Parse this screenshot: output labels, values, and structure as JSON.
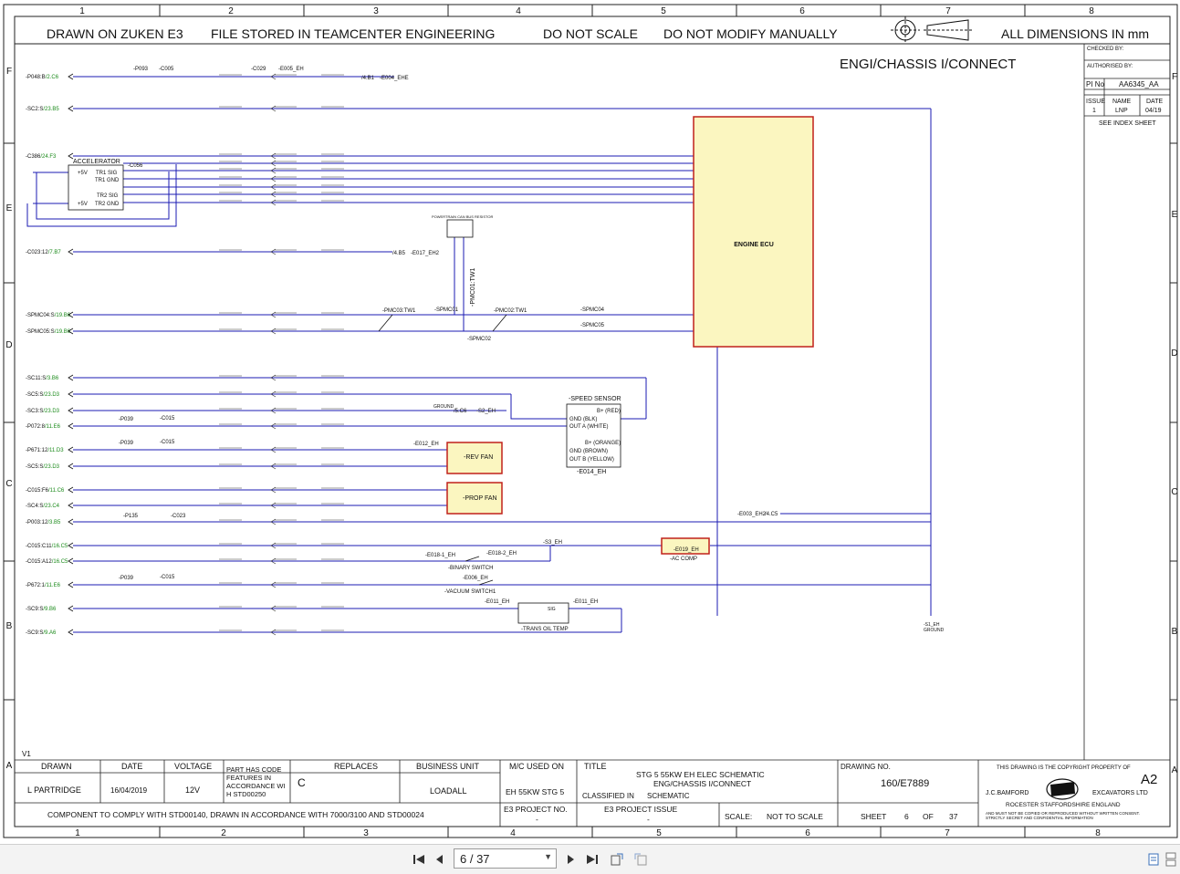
{
  "header": {
    "notes": [
      "DRAWN ON ZUKEN E3",
      "FILE STORED IN TEAMCENTER ENGINEERING",
      "DO NOT SCALE",
      "DO NOT MODIFY MANUALLY"
    ],
    "dimensions": "ALL DIMENSIONS IN mm",
    "sheet_title": "ENGI/CHASSIS I/CONNECT"
  },
  "grid": {
    "columns": [
      "1",
      "2",
      "3",
      "4",
      "5",
      "6",
      "7",
      "8"
    ],
    "rows": [
      "F",
      "E",
      "D",
      "C",
      "B",
      "A"
    ]
  },
  "approval": {
    "checked_by": "CHECKED BY:",
    "authorised_by": "AUTHORISED BY:",
    "pi_label": "PI No",
    "pi_value": "AA6345_AA",
    "issue_label": "ISSUE",
    "name_label": "NAME",
    "date_label": "DATE",
    "issue": "1",
    "name": "LNP",
    "date": "04/19",
    "index_note": "SEE INDEX SHEET"
  },
  "schematic": {
    "left_refs": [
      {
        "ref": "-P048:B",
        "dest": "/2.C6"
      },
      {
        "ref": "-SC2:S",
        "dest": "/23.B5"
      },
      {
        "ref": "-C386",
        "dest": "/24.F3"
      },
      {
        "ref": "-C023:12",
        "dest": "/7.B7"
      },
      {
        "ref": "-SPMC04:S",
        "dest": "/19.B6"
      },
      {
        "ref": "-SPMC05:S",
        "dest": "/19.B6"
      },
      {
        "ref": "-SC11:S",
        "dest": "/3.B6"
      },
      {
        "ref": "-SC5:S",
        "dest": "/23.D3"
      },
      {
        "ref": "-SC3:S",
        "dest": "/23.D3"
      },
      {
        "ref": "-P072:8",
        "dest": "/11.E6"
      },
      {
        "ref": "-P671:12",
        "dest": "/11.D3"
      },
      {
        "ref": "-SC5:S",
        "dest": "/23.D3"
      },
      {
        "ref": "-C015:F6",
        "dest": "/11.C6"
      },
      {
        "ref": "-SC4:S",
        "dest": "/23.C4"
      },
      {
        "ref": "-P003:12",
        "dest": "/3.B5"
      },
      {
        "ref": "-C015:C11",
        "dest": "/16.C5"
      },
      {
        "ref": "-C015:A12",
        "dest": "/16.C5"
      },
      {
        "ref": "-P672:1",
        "dest": "/11.E6"
      },
      {
        "ref": "-SC9:S",
        "dest": "/9.B6"
      },
      {
        "ref": "-SC9:S",
        "dest": "/9.A6"
      }
    ],
    "accelerator": {
      "title": "ACCELERATOR",
      "conn": "-C056",
      "pins": [
        "+5V",
        "TR1 SIG",
        "TR1 GND",
        "TR2 SIG",
        "TR2 GND",
        "+5V"
      ]
    },
    "ecu": {
      "label": "ENGINE ECU"
    },
    "can_resistor": "POWERTRAIN CAN BUS RESISTOR",
    "speed_sensor": {
      "title": "-SPEED SENSOR",
      "ref": "-E014_EH",
      "pins": [
        "B+ (RED)",
        "GND (BLK)",
        "OUT A (WHITE)",
        "B+ (ORANGE)",
        "GND (BROWN)",
        "OUT B (YELLOW)"
      ]
    },
    "rev_fan": "-REV FAN",
    "prop_fan": "-PROP FAN",
    "ac_comp": {
      "label": "-AC COMP",
      "ref": "-E019_EH"
    },
    "binary_switch": "-BINARY SWITCH",
    "vacuum_switch": "-VACUUM SWITCH1",
    "trans_oil_temp": "-TRANS OIL TEMP",
    "ground": {
      "ref": "-S1_EH",
      "label": "GROUND"
    },
    "labels": {
      "p093": "-P093",
      "c005": "-C005",
      "c029": "-C029",
      "e005": "-E005_EH",
      "e004": "-E004_EHE",
      "e004_dest": "/4.B1",
      "e017": "-E017_EH2",
      "e017_dest": "/4.B5",
      "pmc03": "-PMC03:TW1",
      "pmc02": "-PMC02:TW1",
      "pmc01": "-PMC01:TW1",
      "spmc01": "-SPMC01",
      "spmc02": "-SPMC02",
      "spmc04": "-SPMC04",
      "spmc05": "-SPMC05",
      "p039": "-P039",
      "c015": "-C015",
      "ground_tag": "GROUND",
      "ground_dest": "/5.C6",
      "s2eh": "-S2_EH",
      "e012": "-E012_EH",
      "p135": "-P135",
      "c023": "-C023",
      "e003": "-E003_EH2",
      "e003_dest": "/4.C5",
      "s3eh": "-S3_EH",
      "e018_1": "-E018-1_EH",
      "e018_2": "-E018-2_EH",
      "e006": "-E006_EH",
      "e011": "-E011_EH",
      "e011b": "-E011_EH",
      "sig": "SIG"
    },
    "version": "V1"
  },
  "title_block": {
    "drawn_label": "DRAWN",
    "drawn": "L PARTRIDGE",
    "date_label": "DATE",
    "date": "16/04/2019",
    "voltage_label": "VOLTAGE",
    "voltage": "12V",
    "code_note": "PART HAS CODE FEATURES IN ACCORDANCE WITH STD00250",
    "code_letter": "C",
    "replaces_label": "REPLACES",
    "business_unit_label": "BUSINESS UNIT",
    "business_unit": "LOADALL",
    "mc_used_label": "M/C USED ON",
    "mc_used": "EH 55KW STG 5",
    "title_label": "TITLE",
    "title_line1": "STG 5 55KW EH ELEC SCHEMATIC",
    "title_line2": "ENG/CHASSIS I/CONNECT",
    "classified_label": "CLASSIFIED IN",
    "classified": "SCHEMATIC",
    "drawing_no_label": "DRAWING NO.",
    "drawing_no": "160/E7889",
    "copyright": "THIS DRAWING IS THE COPYRIGHT PROPERTY OF",
    "company_short": "J.C.BAMFORD",
    "company_long": "EXCAVATORS LTD",
    "size": "A2",
    "address": "ROCESTER     STAFFORDSHIRE     ENGLAND",
    "secret": "AND MUST NOT BE COPIED OR REPRODUCED WITHOUT WRITTEN CONSENT. STRICTLY SECRET AND CONFIDENTIAL INFORMATION",
    "comply": "COMPONENT TO COMPLY WITH STD00140, DRAWN IN ACCORDANCE WITH 7000/3100 AND STD00024",
    "e3_project_label": "E3 PROJECT NO.",
    "e3_project": "-",
    "e3_issue_label": "E3 PROJECT ISSUE",
    "e3_issue": "-",
    "scale_label": "SCALE:",
    "scale": "NOT TO SCALE",
    "sheet_label": "SHEET",
    "sheet": "6",
    "of_label": "OF",
    "total": "37"
  },
  "viewer": {
    "page": "6 / 37"
  }
}
